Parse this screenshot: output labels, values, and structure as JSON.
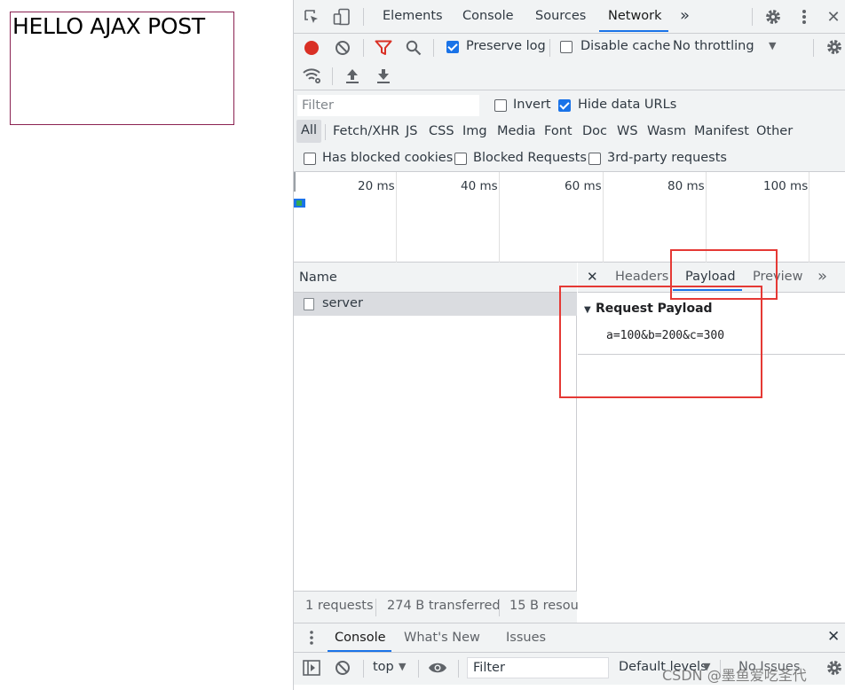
{
  "page": {
    "heading": "HELLO AJAX POST"
  },
  "devtools": {
    "tabs": [
      "Elements",
      "Console",
      "Sources",
      "Network"
    ],
    "selected_tab": "Network",
    "more_tabs_glyph": "»",
    "network_toolbar": {
      "preserve_log": {
        "label": "Preserve log",
        "checked": true
      },
      "disable_cache": {
        "label": "Disable cache",
        "checked": false
      },
      "throttling": "No throttling"
    },
    "filter": {
      "placeholder": "Filter",
      "invert": {
        "label": "Invert",
        "checked": false
      },
      "hide_data_urls": {
        "label": "Hide data URLs",
        "checked": true
      },
      "types": [
        "All",
        "Fetch/XHR",
        "JS",
        "CSS",
        "Img",
        "Media",
        "Font",
        "Doc",
        "WS",
        "Wasm",
        "Manifest",
        "Other"
      ],
      "selected_type": "All",
      "has_blocked_cookies": {
        "label": "Has blocked cookies",
        "checked": false
      },
      "blocked_requests": {
        "label": "Blocked Requests",
        "checked": false
      },
      "third_party": {
        "label": "3rd-party requests",
        "checked": false
      }
    },
    "timeline": {
      "ticks": [
        "20 ms",
        "40 ms",
        "60 ms",
        "80 ms",
        "100 ms"
      ]
    },
    "request_list": {
      "column_name": "Name",
      "requests": [
        {
          "name": "server",
          "selected": true
        }
      ],
      "status": {
        "requests": "1 requests",
        "transferred": "274 B transferred",
        "resources": "15 B resour"
      }
    },
    "detail": {
      "tabs": [
        "Headers",
        "Payload",
        "Preview"
      ],
      "selected_tab": "Payload",
      "section_title": "Request Payload",
      "payload": "a=100&b=200&c=300"
    },
    "drawer": {
      "tabs": [
        "Console",
        "What's New",
        "Issues"
      ],
      "selected_tab": "Console",
      "context": "top",
      "filter_placeholder": "Filter",
      "levels": "Default levels",
      "issues": "No Issues"
    },
    "colors": {
      "accent": "#1a73e8",
      "record": "#d93025",
      "filter_icon": "#d93025",
      "annotation": "#e53935"
    }
  },
  "watermark": "CSDN @墨鱼爱吃圣代"
}
